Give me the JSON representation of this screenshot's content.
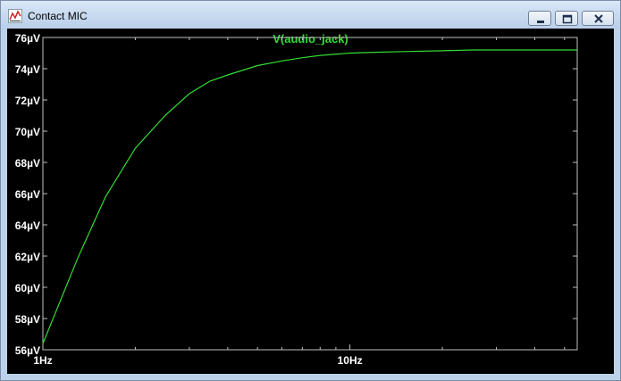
{
  "window": {
    "title": "Contact MIC",
    "app_icon": "waveform-icon",
    "controls": [
      "minimize-icon",
      "maximize-icon",
      "close-icon"
    ]
  },
  "colors": {
    "trace": "#33dd33",
    "background": "#000000",
    "axis": "#c0c0c0",
    "tick_label": "#ffffff"
  },
  "chart_data": {
    "type": "line",
    "title": "V(audio_jack)",
    "xscale": "log",
    "xlim": [
      1,
      55
    ],
    "ylim": [
      56,
      76
    ],
    "yunit": "µV",
    "grid": false,
    "y_ticks": [
      "76µV",
      "74µV",
      "72µV",
      "70µV",
      "68µV",
      "66µV",
      "64µV",
      "62µV",
      "60µV",
      "58µV",
      "56µV"
    ],
    "y_tick_values": [
      76,
      74,
      72,
      70,
      68,
      66,
      64,
      62,
      60,
      58,
      56
    ],
    "x_ticks": [
      "1Hz",
      "10Hz"
    ],
    "x_tick_values": [
      1,
      10
    ],
    "series": [
      {
        "name": "V(audio_jack)",
        "x": [
          1,
          1.3,
          1.6,
          2,
          2.5,
          3,
          3.5,
          4,
          5,
          6,
          7,
          8,
          10,
          12,
          15,
          20,
          25,
          30,
          40,
          55
        ],
        "y": [
          56.4,
          61.9,
          65.8,
          68.9,
          71.0,
          72.4,
          73.2,
          73.6,
          74.2,
          74.5,
          74.7,
          74.85,
          75.0,
          75.05,
          75.1,
          75.15,
          75.2,
          75.2,
          75.2,
          75.2
        ]
      }
    ]
  }
}
